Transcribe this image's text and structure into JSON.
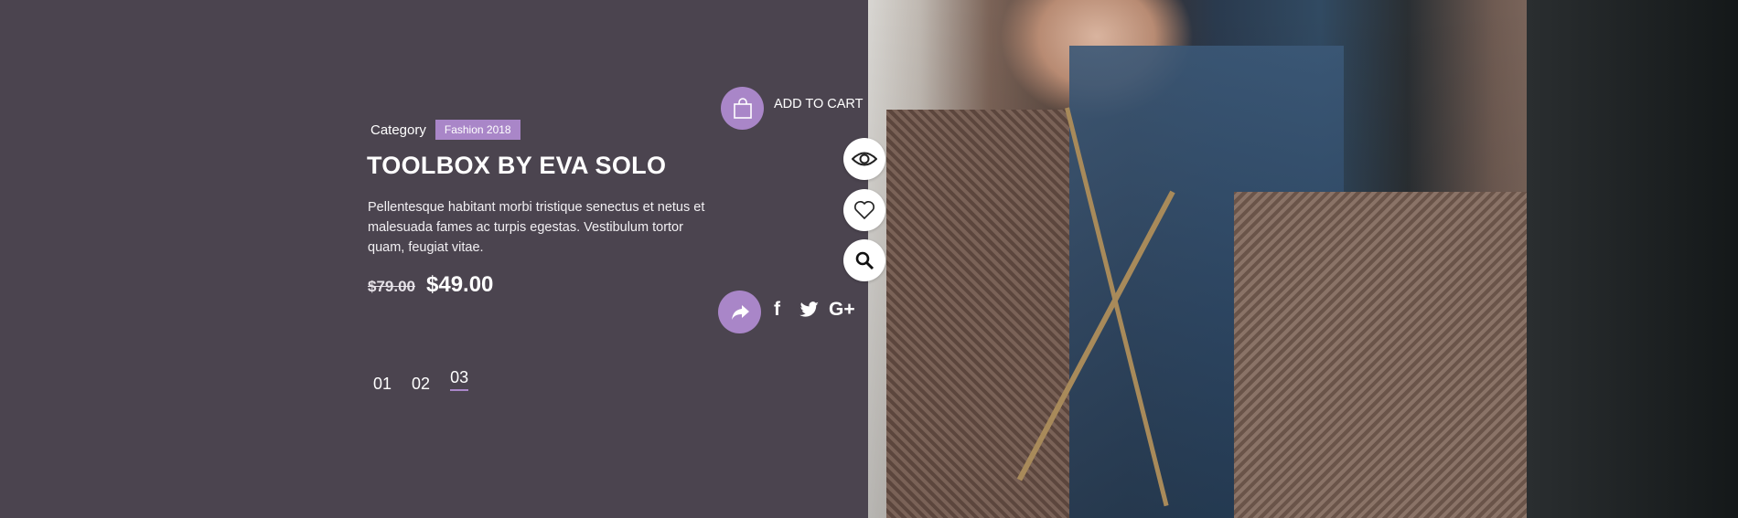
{
  "product": {
    "category_label": "Category",
    "category_badge": "Fashion 2018",
    "title": "TOOLBOX BY EVA SOLO",
    "description": "Pellentesque habitant morbi tristique senectus et netus et malesuada fames ac turpis egestas. Vestibulum tortor quam, feugiat vitae.",
    "old_price": "$79.00",
    "new_price": "$49.00"
  },
  "pager": {
    "items": [
      "01",
      "02",
      "03"
    ],
    "active": "03"
  },
  "actions": {
    "add_to_cart": "ADD TO CART",
    "cart_icon": "shopping-bag-icon",
    "quick_view_icon": "eye-icon",
    "wishlist_icon": "heart-icon",
    "search_icon": "search-icon",
    "share_icon": "share-icon"
  },
  "social": {
    "facebook": "f",
    "google_plus": "G+"
  },
  "colors": {
    "panel": "#4b444f",
    "accent": "#a986c8"
  }
}
